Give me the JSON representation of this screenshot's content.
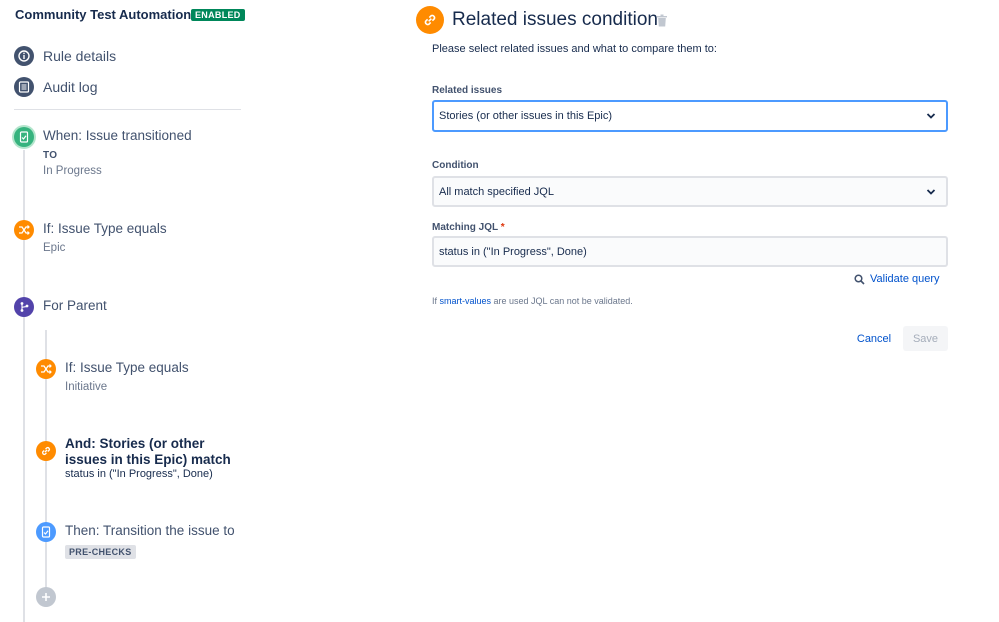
{
  "sidebar": {
    "rule_title": "Community Test Automation",
    "status_badge": "ENABLED",
    "nav": [
      {
        "label": "Rule details",
        "icon": "info-icon"
      },
      {
        "label": "Audit log",
        "icon": "list-icon"
      }
    ],
    "components": {
      "trigger": {
        "title": "When: Issue transitioned",
        "sub_caps": "TO",
        "sub": "In Progress",
        "icon": "transition-icon"
      },
      "condition1": {
        "title": "If: Issue Type equals",
        "sub": "Epic",
        "icon": "shuffle-icon"
      },
      "branch": {
        "title": "For Parent",
        "icon": "branch-icon"
      },
      "condition2": {
        "title": "If: Issue Type equals",
        "sub": "Initiative",
        "icon": "shuffle-icon"
      },
      "condition3": {
        "title": "And: Stories (or other issues in this Epic) match",
        "sub": "status in (\"In Progress\", Done)",
        "icon": "link-icon"
      },
      "action": {
        "title": "Then: Transition the issue to",
        "lozenge": "PRE-CHECKS",
        "icon": "transition-icon"
      }
    },
    "add_component_icon": "plus-icon"
  },
  "panel": {
    "title": "Related issues condition",
    "description": "Please select related issues and what to compare them to:",
    "related_issues": {
      "label": "Related issues",
      "value": "Stories (or other issues in this Epic)"
    },
    "condition": {
      "label": "Condition",
      "value": "All match specified JQL"
    },
    "matching_jql": {
      "label": "Matching JQL",
      "required_marker": "*",
      "value": "status in (\"In Progress\", Done)"
    },
    "validate_label": "Validate query",
    "helper": {
      "prefix": "If ",
      "link": "smart-values",
      "suffix": " are used JQL can not be validated."
    },
    "cancel_label": "Cancel",
    "save_label": "Save"
  },
  "colors": {
    "accent": "#0052cc",
    "enabled_badge": "#00875a",
    "condition_orange": "#ff8b00",
    "trigger_green": "#36b37e",
    "branch_purple": "#5243aa",
    "action_blue": "#4c9aff"
  }
}
